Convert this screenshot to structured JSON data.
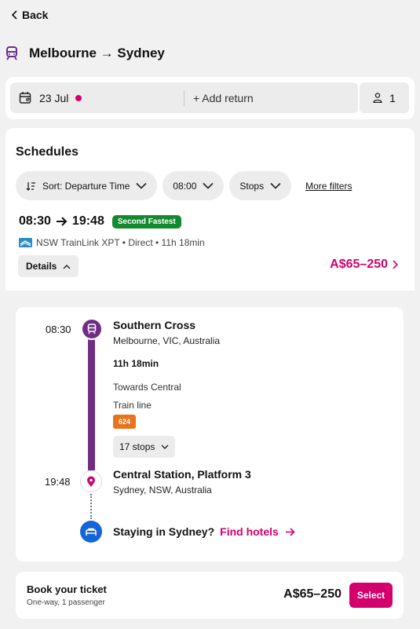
{
  "nav": {
    "back_label": "Back"
  },
  "route": {
    "title": "Melbourne → Sydney"
  },
  "search": {
    "date": "23 Jul",
    "add_return": "+ Add return",
    "passengers": "1"
  },
  "schedules": {
    "title": "Schedules",
    "filters": {
      "sort": "Sort: Departure Time",
      "time": "08:00",
      "stops": "Stops",
      "more": "More filters"
    }
  },
  "result": {
    "depart": "08:30",
    "arrive": "19:48",
    "badge": "Second Fastest",
    "operator": "NSW TrainLink XPT • Direct • 11h 18min",
    "details_label": "Details",
    "price": "A$65–250"
  },
  "itinerary": {
    "depart_time": "08:30",
    "origin": {
      "name": "Southern Cross",
      "location": "Melbourne, VIC, Australia"
    },
    "duration": "11h 18min",
    "towards": "Towards Central",
    "line_type": "Train line",
    "line_number": "624",
    "stops_label": "17 stops",
    "arrive_time": "19:48",
    "destination": {
      "name": "Central Station, Platform 3",
      "location": "Sydney, NSW, Australia"
    },
    "hotel_prompt": "Staying in Sydney?",
    "hotel_link": "Find hotels"
  },
  "booking": {
    "title": "Book your ticket",
    "subtitle": "One-way, 1 passenger",
    "price": "A$65–250",
    "select_label": "Select"
  },
  "colors": {
    "accent": "#d4006e",
    "train": "#6f2d85",
    "badge_green": "#148a2e",
    "line_orange": "#e9741e",
    "hotel_blue": "#1565d8"
  }
}
